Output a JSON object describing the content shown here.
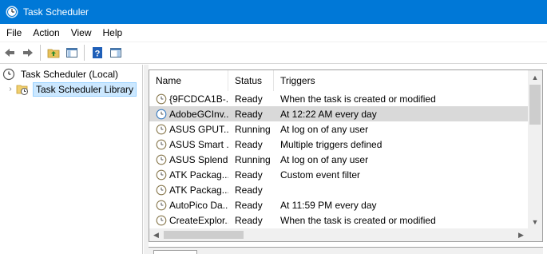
{
  "window": {
    "title": "Task Scheduler",
    "accent": "#0078d7"
  },
  "menu": [
    "File",
    "Action",
    "View",
    "Help"
  ],
  "toolbar": [
    "back-arrow-icon",
    "forward-arrow-icon",
    "folder-up-icon",
    "show-hide-pane-icon",
    "help-icon",
    "action-pane-icon"
  ],
  "tree": {
    "root": "Task Scheduler (Local)",
    "child": "Task Scheduler Library"
  },
  "list": {
    "columns": {
      "name": "Name",
      "status": "Status",
      "triggers": "Triggers"
    },
    "rows": [
      {
        "name": "{9FCDCA1B-...",
        "status": "Ready",
        "triggers": "When the task is created or modified"
      },
      {
        "name": "AdobeGCInv...",
        "status": "Ready",
        "triggers": "At 12:22 AM every day"
      },
      {
        "name": "ASUS GPUT...",
        "status": "Running",
        "triggers": "At log on of any user"
      },
      {
        "name": "ASUS Smart ...",
        "status": "Ready",
        "triggers": "Multiple triggers defined"
      },
      {
        "name": "ASUS Splend...",
        "status": "Running",
        "triggers": "At log on of any user"
      },
      {
        "name": "ATK Packag...",
        "status": "Ready",
        "triggers": "Custom event filter"
      },
      {
        "name": "ATK Packag...",
        "status": "Ready",
        "triggers": ""
      },
      {
        "name": "AutoPico Da...",
        "status": "Ready",
        "triggers": "At 11:59 PM every day"
      },
      {
        "name": "CreateExplor...",
        "status": "Ready",
        "triggers": "When the task is created or modified"
      }
    ]
  }
}
